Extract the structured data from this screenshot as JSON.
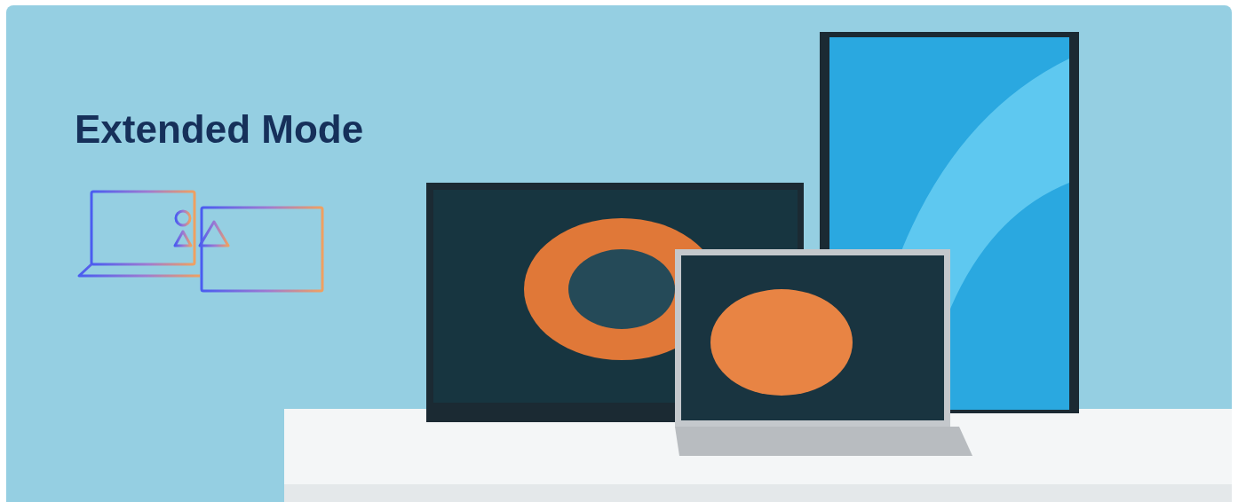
{
  "banner": {
    "heading": "Extended Mode"
  }
}
